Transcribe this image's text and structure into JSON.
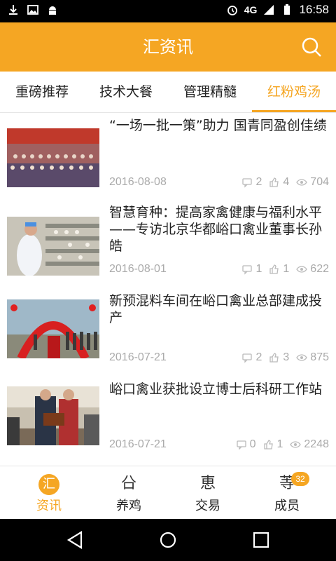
{
  "status_bar": {
    "time": "16:58",
    "network": "4G",
    "left_icons": [
      "download-icon",
      "image-icon",
      "android-icon"
    ],
    "right_icons": [
      "alarm-icon",
      "signal-icon",
      "battery-icon"
    ]
  },
  "app_bar": {
    "title": "汇资讯",
    "search_icon": "search-icon",
    "color": "#f5a623"
  },
  "tabs": [
    {
      "label": "重磅推荐",
      "active": false
    },
    {
      "label": "技术大餐",
      "active": false
    },
    {
      "label": "管理精髓",
      "active": false
    },
    {
      "label": "红粉鸡汤",
      "active": true
    }
  ],
  "articles": [
    {
      "title": "“一场一批一策”助力  国青同盈创佳绩",
      "date": "2016-08-08",
      "comments": "2",
      "likes": "4",
      "views": "704"
    },
    {
      "title": "智慧育种：提高家禽健康与福利水平——专访北京华都峪口禽业董事长孙皓",
      "date": "2016-08-01",
      "comments": "1",
      "likes": "1",
      "views": "622"
    },
    {
      "title": "新预混料车间在峪口禽业总部建成投产",
      "date": "2016-07-21",
      "comments": "2",
      "likes": "3",
      "views": "875"
    },
    {
      "title": "峪口禽业获批设立博士后科研工作站",
      "date": "2016-07-21",
      "comments": "0",
      "likes": "1",
      "views": "2248"
    }
  ],
  "bottom_nav": [
    {
      "label": "资讯",
      "glyph": "汇",
      "active": true
    },
    {
      "label": "养鸡",
      "glyph": "㕣",
      "active": false
    },
    {
      "label": "交易",
      "glyph": "恵",
      "active": false
    },
    {
      "label": "成员",
      "glyph": "䓁",
      "active": false,
      "badge": "32"
    }
  ],
  "system_nav": [
    "back-icon",
    "home-icon",
    "recents-icon"
  ]
}
